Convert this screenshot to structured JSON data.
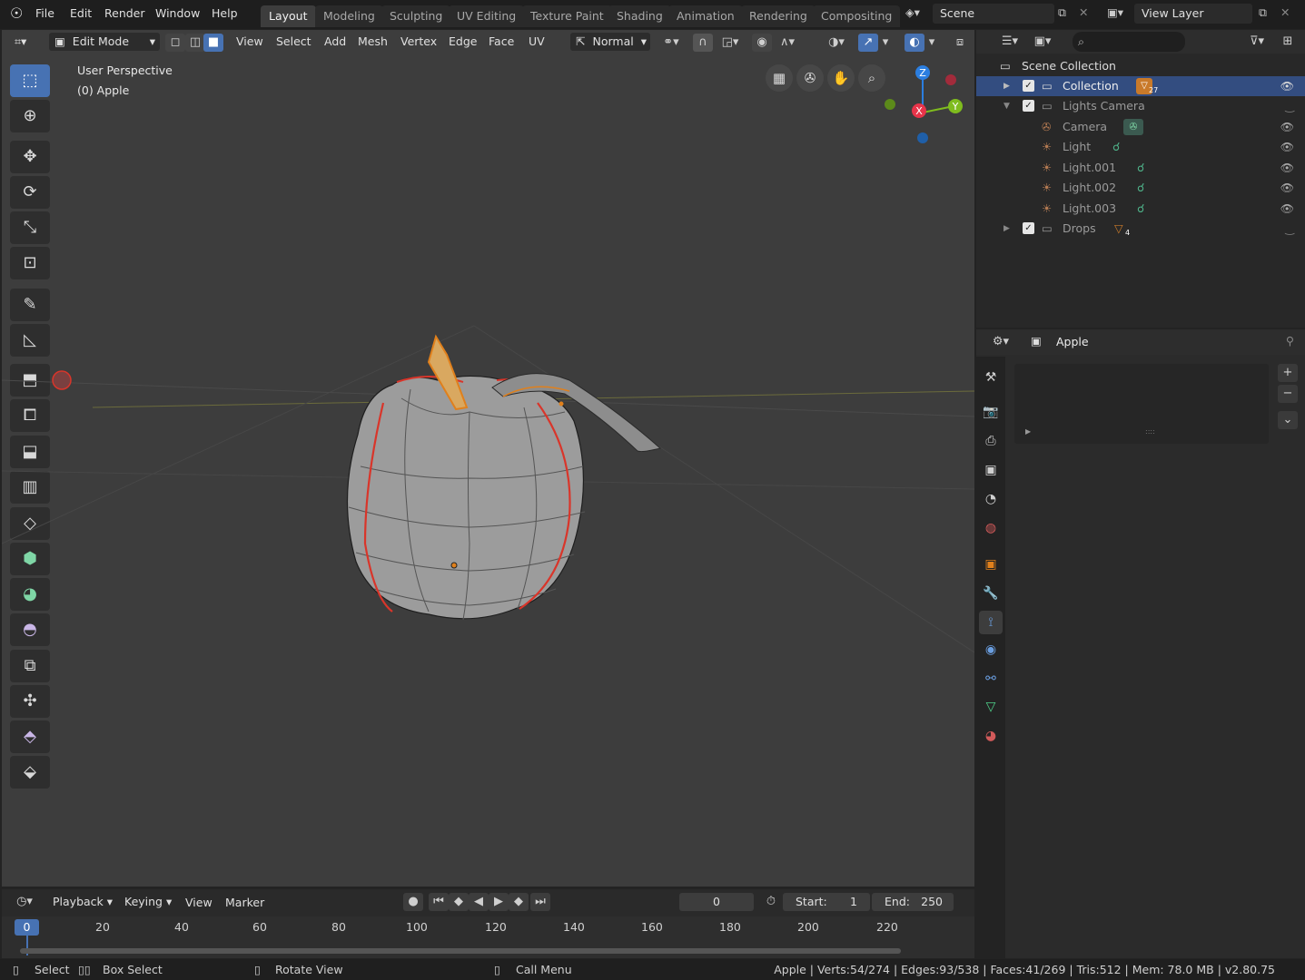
{
  "topbar": {
    "menus": [
      "File",
      "Edit",
      "Render",
      "Window",
      "Help"
    ],
    "workspaces": [
      "Layout",
      "Modeling",
      "Sculpting",
      "UV Editing",
      "Texture Paint",
      "Shading",
      "Animation",
      "Rendering",
      "Compositing"
    ],
    "active_workspace": "Layout",
    "scene": "Scene",
    "view_layer": "View Layer"
  },
  "viewport": {
    "mode": "Edit Mode",
    "menus": [
      "View",
      "Select",
      "Add",
      "Mesh",
      "Vertex",
      "Edge",
      "Face",
      "UV"
    ],
    "orientation": "Normal",
    "overlay_title": "User Perspective",
    "overlay_object": "(0) Apple",
    "gizmo_axes": {
      "z": "Z",
      "x": "X",
      "y": "Y"
    },
    "colors": {
      "x": "#e8344a",
      "y": "#7fbc1e",
      "z": "#2b7ee0",
      "selected_edge": "#d9352a",
      "active": "#e0801c"
    }
  },
  "outliner": {
    "root": "Scene Collection",
    "rows": [
      {
        "label": "Collection",
        "badge": "27",
        "selected": true
      },
      {
        "label": "Lights Camera",
        "selected": false
      },
      {
        "label": "Camera",
        "selected": false
      },
      {
        "label": "Light",
        "selected": false
      },
      {
        "label": "Light.001",
        "selected": false
      },
      {
        "label": "Light.002",
        "selected": false
      },
      {
        "label": "Light.003",
        "selected": false
      },
      {
        "label": "Drops",
        "badge": "4",
        "selected": false
      }
    ]
  },
  "properties": {
    "object_name": "Apple"
  },
  "timeline": {
    "menus": [
      "Playback",
      "Keying",
      "View",
      "Marker"
    ],
    "current_frame": "0",
    "start_label": "Start:",
    "start": "1",
    "end_label": "End:",
    "end": "250",
    "ticks": [
      "0",
      "20",
      "40",
      "60",
      "80",
      "100",
      "120",
      "140",
      "160",
      "180",
      "200",
      "220"
    ]
  },
  "statusbar": {
    "select": "Select",
    "box_select": "Box Select",
    "rotate_view": "Rotate View",
    "call_menu": "Call Menu",
    "stats": "Apple | Verts:54/274 | Edges:93/538 | Faces:41/269 | Tris:512 | Mem: 78.0 MB | v2.80.75"
  }
}
